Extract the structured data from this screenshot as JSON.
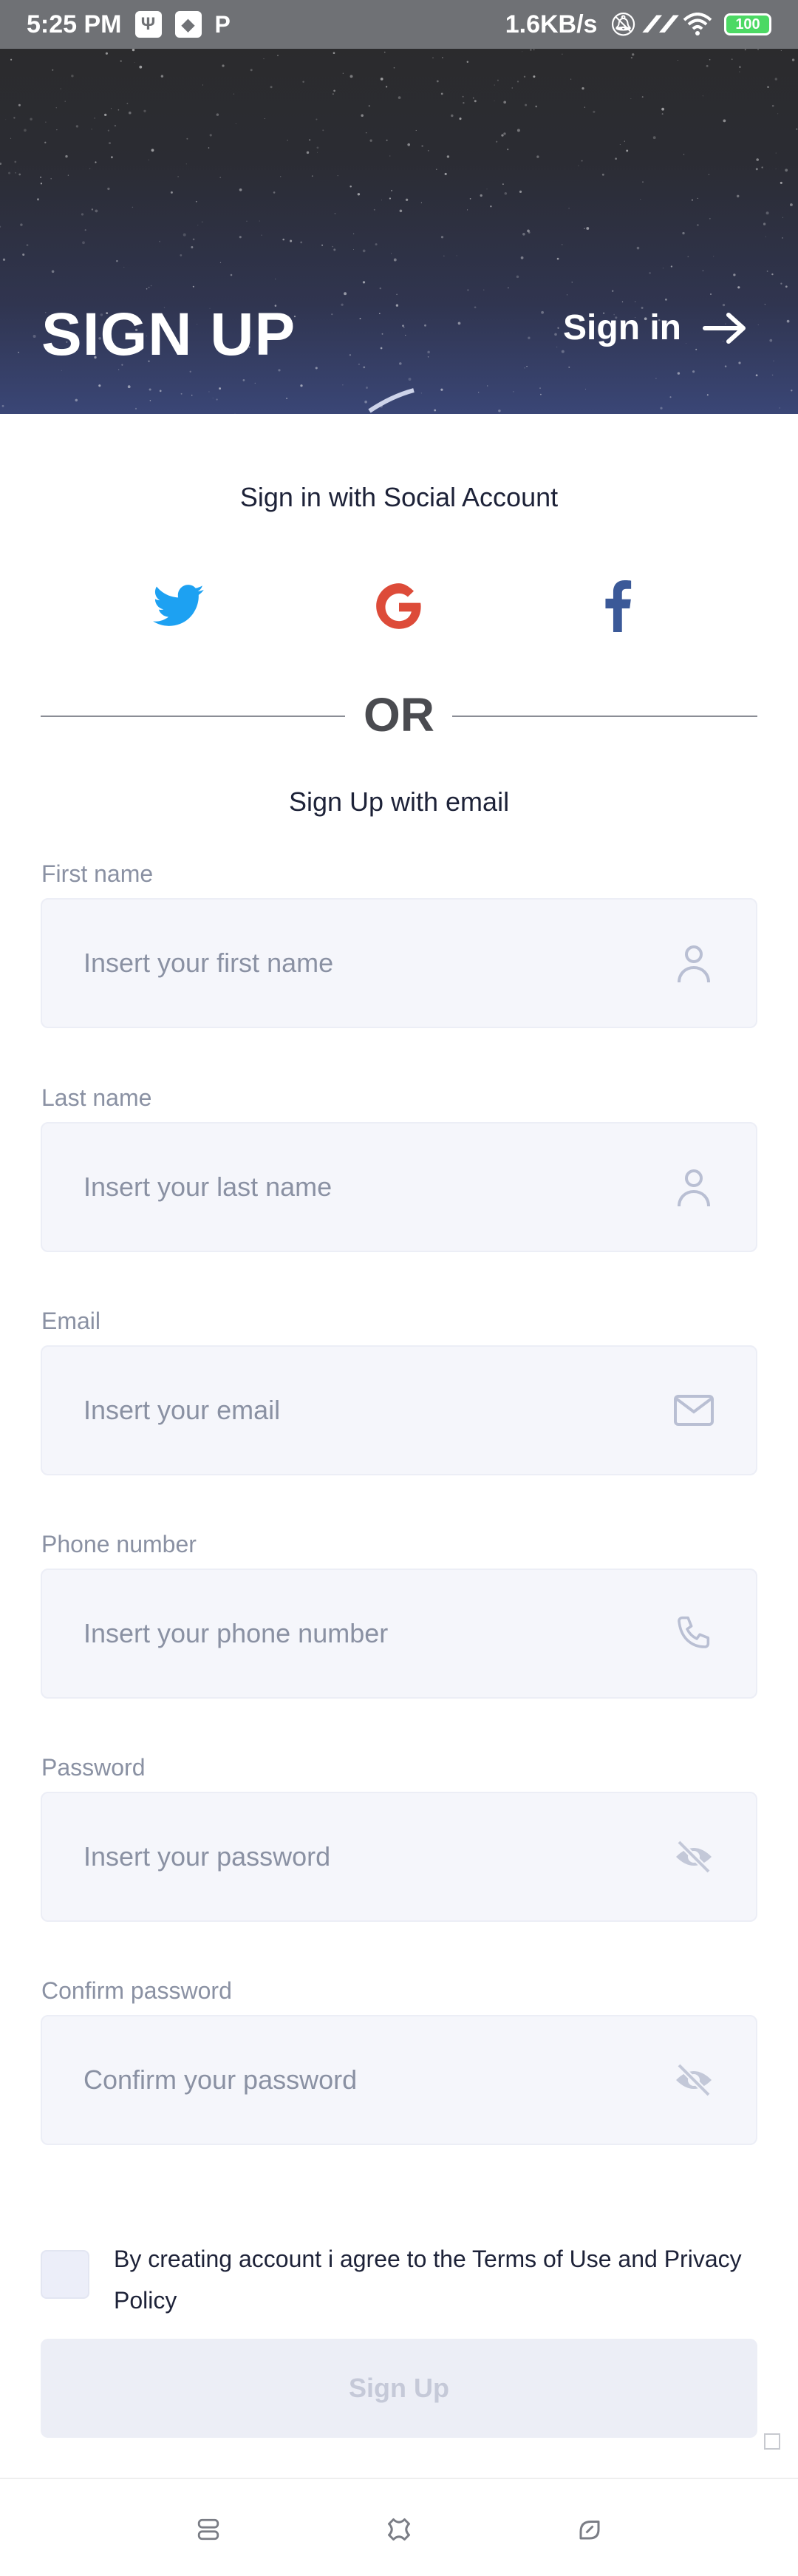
{
  "status_bar": {
    "time": "5:25 PM",
    "net_speed": "1.6KB/s",
    "signal_a": "⁄⁄⁄⁄",
    "signal_b": "⁄⁄⁄⁄",
    "battery": "100",
    "icons": [
      "usb-icon",
      "shield-icon",
      "p-icon",
      "mute-icon",
      "wifi-icon"
    ]
  },
  "hero": {
    "title": "SIGN UP",
    "signin_label": "Sign in"
  },
  "social": {
    "heading": "Sign in with Social Account",
    "twitter_color": "#1da1f2",
    "google_color": "#dd4b39",
    "facebook_color": "#3b5998"
  },
  "divider": {
    "or_text": "OR"
  },
  "email_heading": "Sign Up with email",
  "fields": {
    "first_name": {
      "label": "First name",
      "placeholder": "Insert your first name",
      "icon": "person-icon"
    },
    "last_name": {
      "label": "Last name",
      "placeholder": "Insert your last name",
      "icon": "person-icon"
    },
    "email": {
      "label": "Email",
      "placeholder": "Insert your email",
      "icon": "mail-icon"
    },
    "phone": {
      "label": "Phone number",
      "placeholder": "Insert your phone number",
      "icon": "phone-icon"
    },
    "password": {
      "label": "Password",
      "placeholder": "Insert your password",
      "icon": "eye-off-icon"
    },
    "confirm_password": {
      "label": "Confirm password",
      "placeholder": "Confirm your password",
      "icon": "eye-off-icon"
    }
  },
  "agreement": {
    "text": "By creating account i agree to the Terms of Use and Privacy Policy",
    "checked": false
  },
  "signup_button": "Sign Up",
  "colors": {
    "accent_icon": "#b9bfd3",
    "field_bg": "#f5f6fb",
    "label": "#8a91a3",
    "hero_bottom": "#3a4676"
  }
}
